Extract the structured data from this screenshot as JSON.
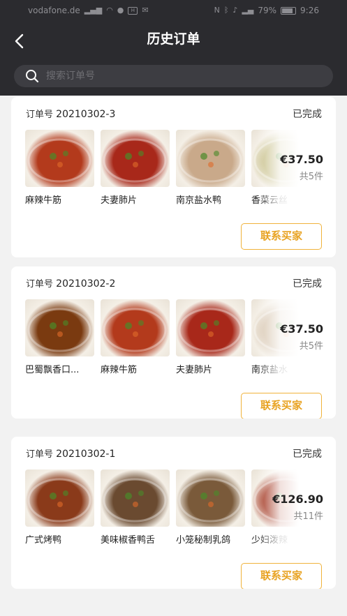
{
  "status_bar": {
    "carrier": "vodafone.de",
    "battery": "79%",
    "time": "9:26",
    "app_badge": "H"
  },
  "header": {
    "title": "历史订单",
    "back_icon": "chevron-left-icon"
  },
  "search": {
    "placeholder": "搜索订单号",
    "icon": "search-icon"
  },
  "orders": [
    {
      "label": "订单号",
      "number": "20210302-3",
      "status": "已完成",
      "total": "€37.50",
      "count": "共5件",
      "button": "联系买家",
      "items": [
        {
          "name": "麻辣牛筋",
          "color": "#b33a1c"
        },
        {
          "name": "夫妻肺片",
          "color": "#a8281a"
        },
        {
          "name": "南京盐水鸭",
          "color": "#c9a98a"
        },
        {
          "name": "香菜云丝",
          "color": "#c8c08a"
        }
      ]
    },
    {
      "label": "订单号",
      "number": "20210302-2",
      "status": "已完成",
      "total": "€37.50",
      "count": "共5件",
      "button": "联系买家",
      "items": [
        {
          "name": "巴蜀飘香口...",
          "color": "#7a3a10"
        },
        {
          "name": "麻辣牛筋",
          "color": "#b33a1c"
        },
        {
          "name": "夫妻肺片",
          "color": "#a8281a"
        },
        {
          "name": "南京盐水",
          "color": "#d8c7b2"
        }
      ]
    },
    {
      "label": "订单号",
      "number": "20210302-1",
      "status": "已完成",
      "total": "€126.90",
      "count": "共11件",
      "button": "联系买家",
      "items": [
        {
          "name": "广式烤鸭",
          "color": "#8a3a1a"
        },
        {
          "name": "美味椒香鸭舌",
          "color": "#6a4a30"
        },
        {
          "name": "小笼秘制乳鸽",
          "color": "#7a5a3a"
        },
        {
          "name": "少妇泼辣",
          "color": "#a0301a"
        }
      ]
    }
  ]
}
